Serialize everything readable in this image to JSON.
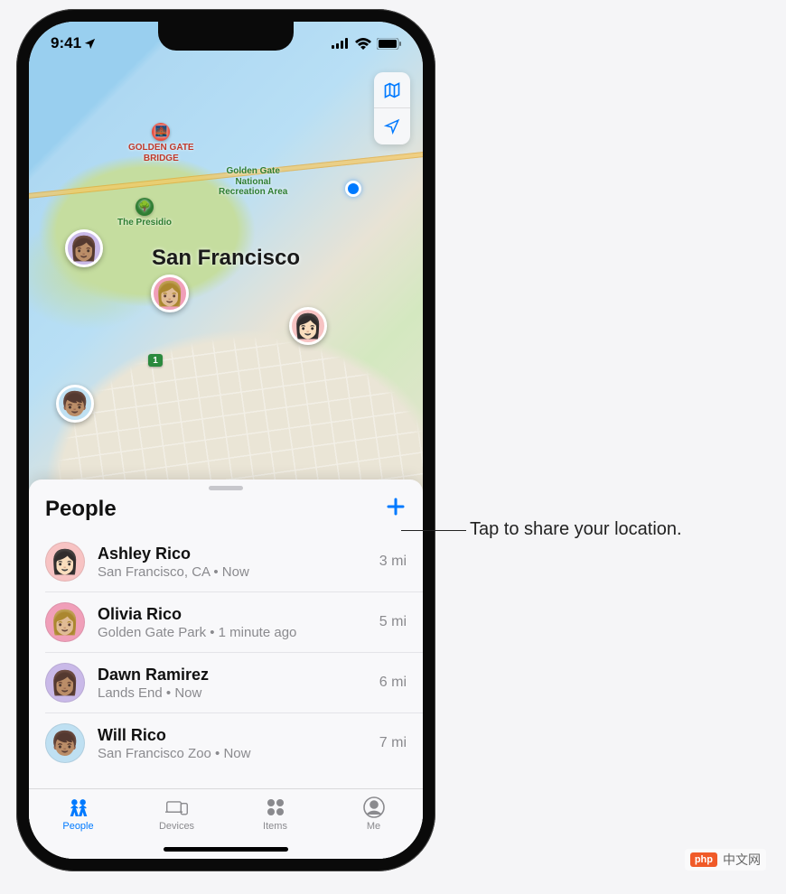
{
  "status": {
    "time": "9:41"
  },
  "map": {
    "city": "San Francisco",
    "poi": {
      "ggb": "GOLDEN GATE\nBRIDGE",
      "presidio": "The Presidio",
      "ggnra": "Golden Gate\nNational\nRecreation Area"
    },
    "route_badge": "1"
  },
  "panel": {
    "title": "People"
  },
  "people": [
    {
      "name": "Ashley Rico",
      "location": "San Francisco, CA • Now",
      "distance": "3 mi",
      "avatar_bg": "#f7c3c3"
    },
    {
      "name": "Olivia Rico",
      "location": "Golden Gate Park • 1 minute ago",
      "distance": "5 mi",
      "avatar_bg": "#f09fb9"
    },
    {
      "name": "Dawn Ramirez",
      "location": "Lands End • Now",
      "distance": "6 mi",
      "avatar_bg": "#c9b9e8"
    },
    {
      "name": "Will Rico",
      "location": "San Francisco Zoo • Now",
      "distance": "7 mi",
      "avatar_bg": "#bfe0f2"
    }
  ],
  "tabs": [
    {
      "label": "People",
      "active": true
    },
    {
      "label": "Devices",
      "active": false
    },
    {
      "label": "Items",
      "active": false
    },
    {
      "label": "Me",
      "active": false
    }
  ],
  "callout": "Tap to share your location.",
  "watermark": {
    "logo": "php",
    "text": "中文网"
  }
}
